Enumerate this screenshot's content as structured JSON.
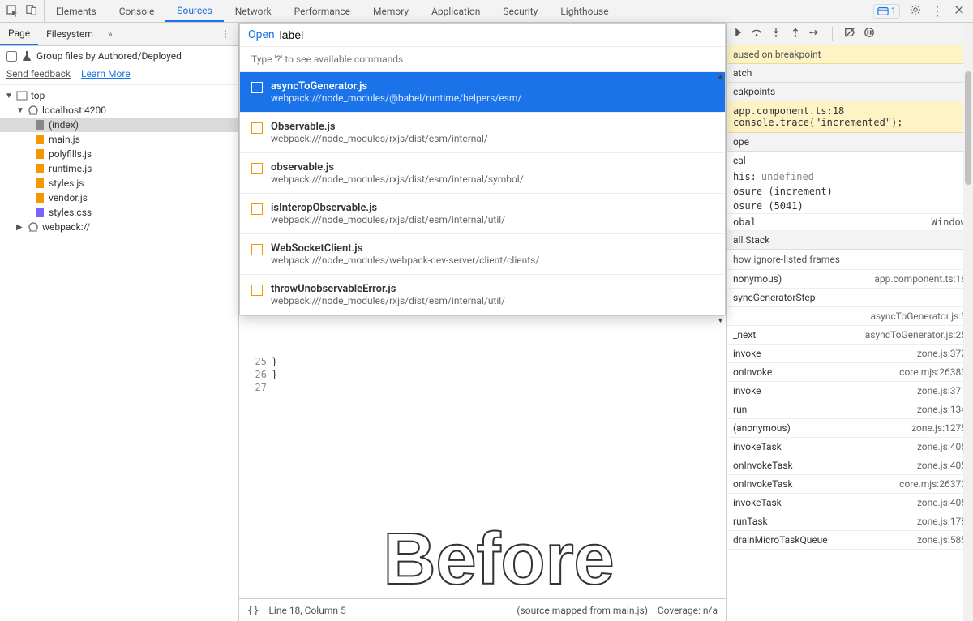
{
  "topTabs": [
    "Elements",
    "Console",
    "Sources",
    "Network",
    "Performance",
    "Memory",
    "Application",
    "Security",
    "Lighthouse"
  ],
  "topActive": "Sources",
  "issuesCount": "1",
  "leftTabs": {
    "page": "Page",
    "filesystem": "Filesystem"
  },
  "groupLabel": "Group files by Authored/Deployed",
  "feedbackLink": "Send feedback",
  "learnMoreLink": "Learn More",
  "tree": {
    "top": "top",
    "host": "localhost:4200",
    "files": [
      "(index)",
      "main.js",
      "polyfills.js",
      "runtime.js",
      "styles.js",
      "vendor.js",
      "styles.css"
    ],
    "webpack": "webpack://"
  },
  "popup": {
    "openLabel": "Open",
    "query": "label",
    "hint": "Type '?' to see available commands",
    "items": [
      {
        "title": "asyncToGenerator.js",
        "path": "webpack:///node_modules/@babel/runtime/helpers/esm/"
      },
      {
        "title": "Observable.js",
        "path": "webpack:///node_modules/rxjs/dist/esm/internal/"
      },
      {
        "title": "observable.js",
        "path": "webpack:///node_modules/rxjs/dist/esm/internal/symbol/"
      },
      {
        "title": "isInteropObservable.js",
        "path": "webpack:///node_modules/rxjs/dist/esm/internal/util/"
      },
      {
        "title": "WebSocketClient.js",
        "path": "webpack:///node_modules/webpack-dev-server/client/clients/"
      },
      {
        "title": "throwUnobservableError.js",
        "path": "webpack:///node_modules/rxjs/dist/esm/internal/util/"
      }
    ]
  },
  "editor": {
    "lines": [
      "25",
      "26",
      "27"
    ],
    "code": [
      "    }",
      "}",
      ""
    ]
  },
  "beforeText": "Before",
  "status": {
    "braces": "{}",
    "pos": "Line 18, Column 5",
    "mapped": "(source mapped from ",
    "mappedFile": "main.js",
    "mappedEnd": ")",
    "coverage": "Coverage: n/a"
  },
  "pauseBanner": "aused on breakpoint",
  "sections": {
    "watch": "atch",
    "breakpoints": "eakpoints",
    "scope": "ope",
    "local": "cal",
    "global": "obal",
    "callstack": "all Stack"
  },
  "bp": {
    "file": "app.component.ts:18",
    "code": "console.trace(\"incremented\");"
  },
  "scope": {
    "this": "his:",
    "thisVal": "undefined",
    "closure1": "osure (increment)",
    "closure2": "osure (5041)",
    "globalType": "Window"
  },
  "csOption": "how ignore-listed frames",
  "stack": [
    {
      "fn": "nonymous)",
      "loc": "app.component.ts:18"
    },
    {
      "fn": "syncGeneratorStep",
      "loc": ""
    },
    {
      "fn": "",
      "loc": "asyncToGenerator.js:3"
    },
    {
      "fn": "_next",
      "loc": "asyncToGenerator.js:25"
    },
    {
      "fn": "invoke",
      "loc": "zone.js:372"
    },
    {
      "fn": "onInvoke",
      "loc": "core.mjs:26383"
    },
    {
      "fn": "invoke",
      "loc": "zone.js:371"
    },
    {
      "fn": "run",
      "loc": "zone.js:134"
    },
    {
      "fn": "(anonymous)",
      "loc": "zone.js:1275"
    },
    {
      "fn": "invokeTask",
      "loc": "zone.js:406"
    },
    {
      "fn": "onInvokeTask",
      "loc": "zone.js:405"
    },
    {
      "fn": "onInvokeTask",
      "loc": "core.mjs:26370"
    },
    {
      "fn": "invokeTask",
      "loc": "zone.js:405"
    },
    {
      "fn": "runTask",
      "loc": "zone.js:178"
    },
    {
      "fn": "drainMicroTaskQueue",
      "loc": "zone.js:585"
    }
  ]
}
